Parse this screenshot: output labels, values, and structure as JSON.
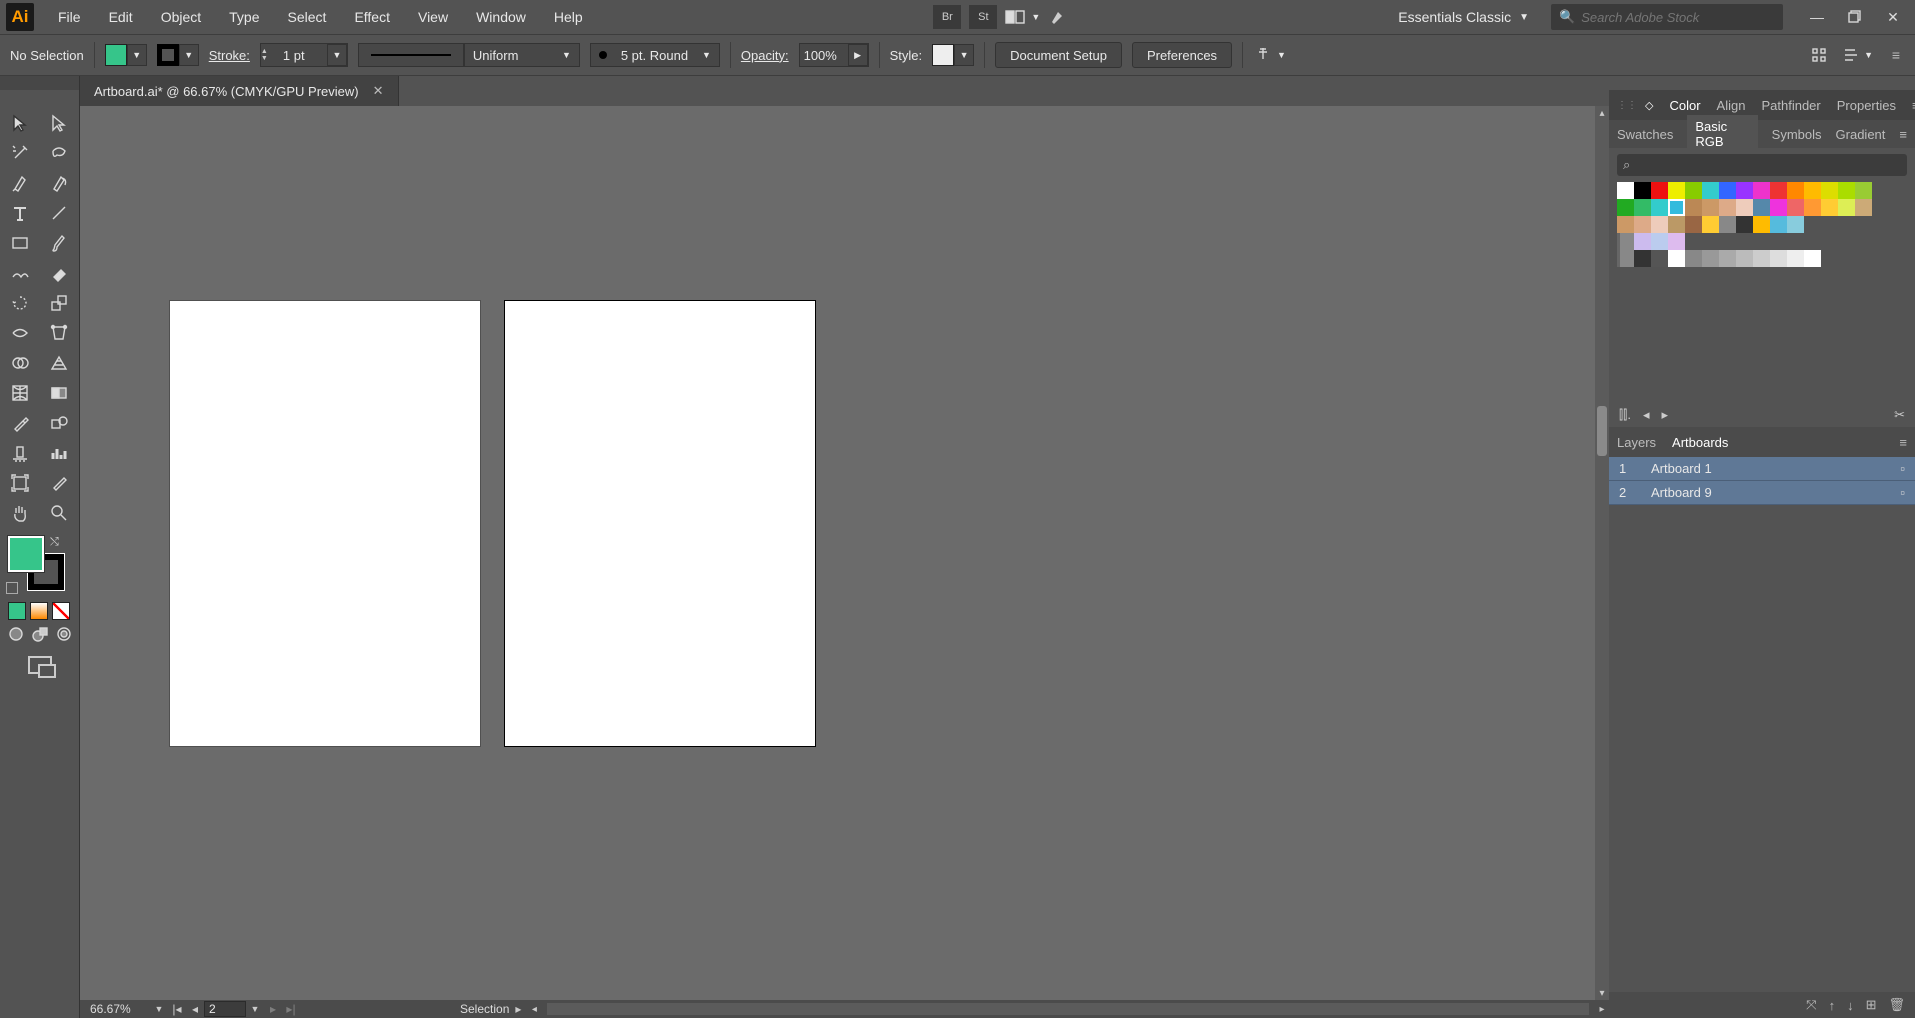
{
  "menu": {
    "items": [
      "File",
      "Edit",
      "Object",
      "Type",
      "Select",
      "Effect",
      "View",
      "Window",
      "Help"
    ]
  },
  "menubar_right": {
    "bridge_label": "Br",
    "stock_label": "St",
    "workspace": "Essentials Classic",
    "search_placeholder": "Search Adobe Stock"
  },
  "optbar": {
    "status": "No Selection",
    "fill_color": "#36c58a",
    "stroke_color": "#000000",
    "stroke_label": "Stroke:",
    "stroke_weight": "1 pt",
    "var_width": "Uniform",
    "brush": "5 pt. Round",
    "opacity_label": "Opacity:",
    "opacity_value": "100%",
    "style_label": "Style:",
    "btn_docsetup": "Document Setup",
    "btn_prefs": "Preferences"
  },
  "ministrip": "",
  "doctab": {
    "title": "Artboard.ai* @ 66.67% (CMYK/GPU Preview)"
  },
  "footer": {
    "zoom": "66.67%",
    "artboard_field": "2",
    "tool": "Selection"
  },
  "panels": {
    "top_tabs": [
      "Color",
      "Align",
      "Pathfinder",
      "Properties"
    ],
    "top_active": 0,
    "sub_tabs": [
      "Swatches",
      "Basic RGB",
      "Symbols",
      "Gradient"
    ],
    "sub_active": 1,
    "swatch_rows": [
      [
        "#ffffff",
        "#000000",
        "#e11",
        "#ee0",
        "#8c0",
        "#3cc",
        "#36f",
        "#93f",
        "#e3c",
        "#e33",
        "#f80",
        "#fb0",
        "#dd0",
        "#ad0",
        "#9c3"
      ],
      [
        "#2a2",
        "#3b6",
        "#3cc",
        "#3bd",
        "#b85",
        "#c96",
        "#da8",
        "#ecb",
        "#58a",
        "#e3d",
        "#e66",
        "#f93",
        "#fc3",
        "#de5",
        "#ca7"
      ],
      [
        "#c96",
        "#da8",
        "#ecb",
        "#b96",
        "#964",
        "#fc3",
        "#888",
        "#333",
        "#fb0",
        "#5bd",
        "#8cd"
      ],
      [
        "folder",
        "#cbe",
        "#bce",
        "#dbe"
      ],
      [
        "folder",
        "#333",
        "#555",
        "none",
        "#888",
        "#999",
        "#aaa",
        "#bbb",
        "#ccc",
        "#ddd",
        "#eee",
        "#fff"
      ]
    ],
    "layers_tabs": [
      "Layers",
      "Artboards"
    ],
    "layers_active": 1,
    "artboards": [
      {
        "num": "1",
        "name": "Artboard 1"
      },
      {
        "num": "2",
        "name": "Artboard 9"
      }
    ]
  },
  "colors": {
    "accent": "#36c58a"
  }
}
